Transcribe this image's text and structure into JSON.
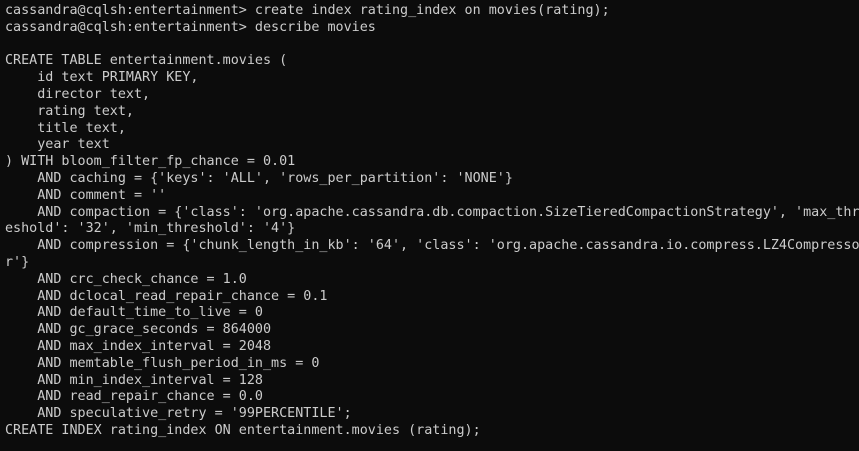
{
  "terminal": {
    "lines": [
      "cassandra@cqlsh:entertainment> create index rating_index on movies(rating);",
      "cassandra@cqlsh:entertainment> describe movies",
      "",
      "CREATE TABLE entertainment.movies (",
      "    id text PRIMARY KEY,",
      "    director text,",
      "    rating text,",
      "    title text,",
      "    year text",
      ") WITH bloom_filter_fp_chance = 0.01",
      "    AND caching = {'keys': 'ALL', 'rows_per_partition': 'NONE'}",
      "    AND comment = ''",
      "    AND compaction = {'class': 'org.apache.cassandra.db.compaction.SizeTieredCompactionStrategy', 'max_thr",
      "eshold': '32', 'min_threshold': '4'}",
      "    AND compression = {'chunk_length_in_kb': '64', 'class': 'org.apache.cassandra.io.compress.LZ4Compresso",
      "r'}",
      "    AND crc_check_chance = 1.0",
      "    AND dclocal_read_repair_chance = 0.1",
      "    AND default_time_to_live = 0",
      "    AND gc_grace_seconds = 864000",
      "    AND max_index_interval = 2048",
      "    AND memtable_flush_period_in_ms = 0",
      "    AND min_index_interval = 128",
      "    AND read_repair_chance = 0.0",
      "    AND speculative_retry = '99PERCENTILE';",
      "CREATE INDEX rating_index ON entertainment.movies (rating);"
    ]
  },
  "colors": {
    "background": "#0c0c0c",
    "foreground": "#cccccc"
  }
}
